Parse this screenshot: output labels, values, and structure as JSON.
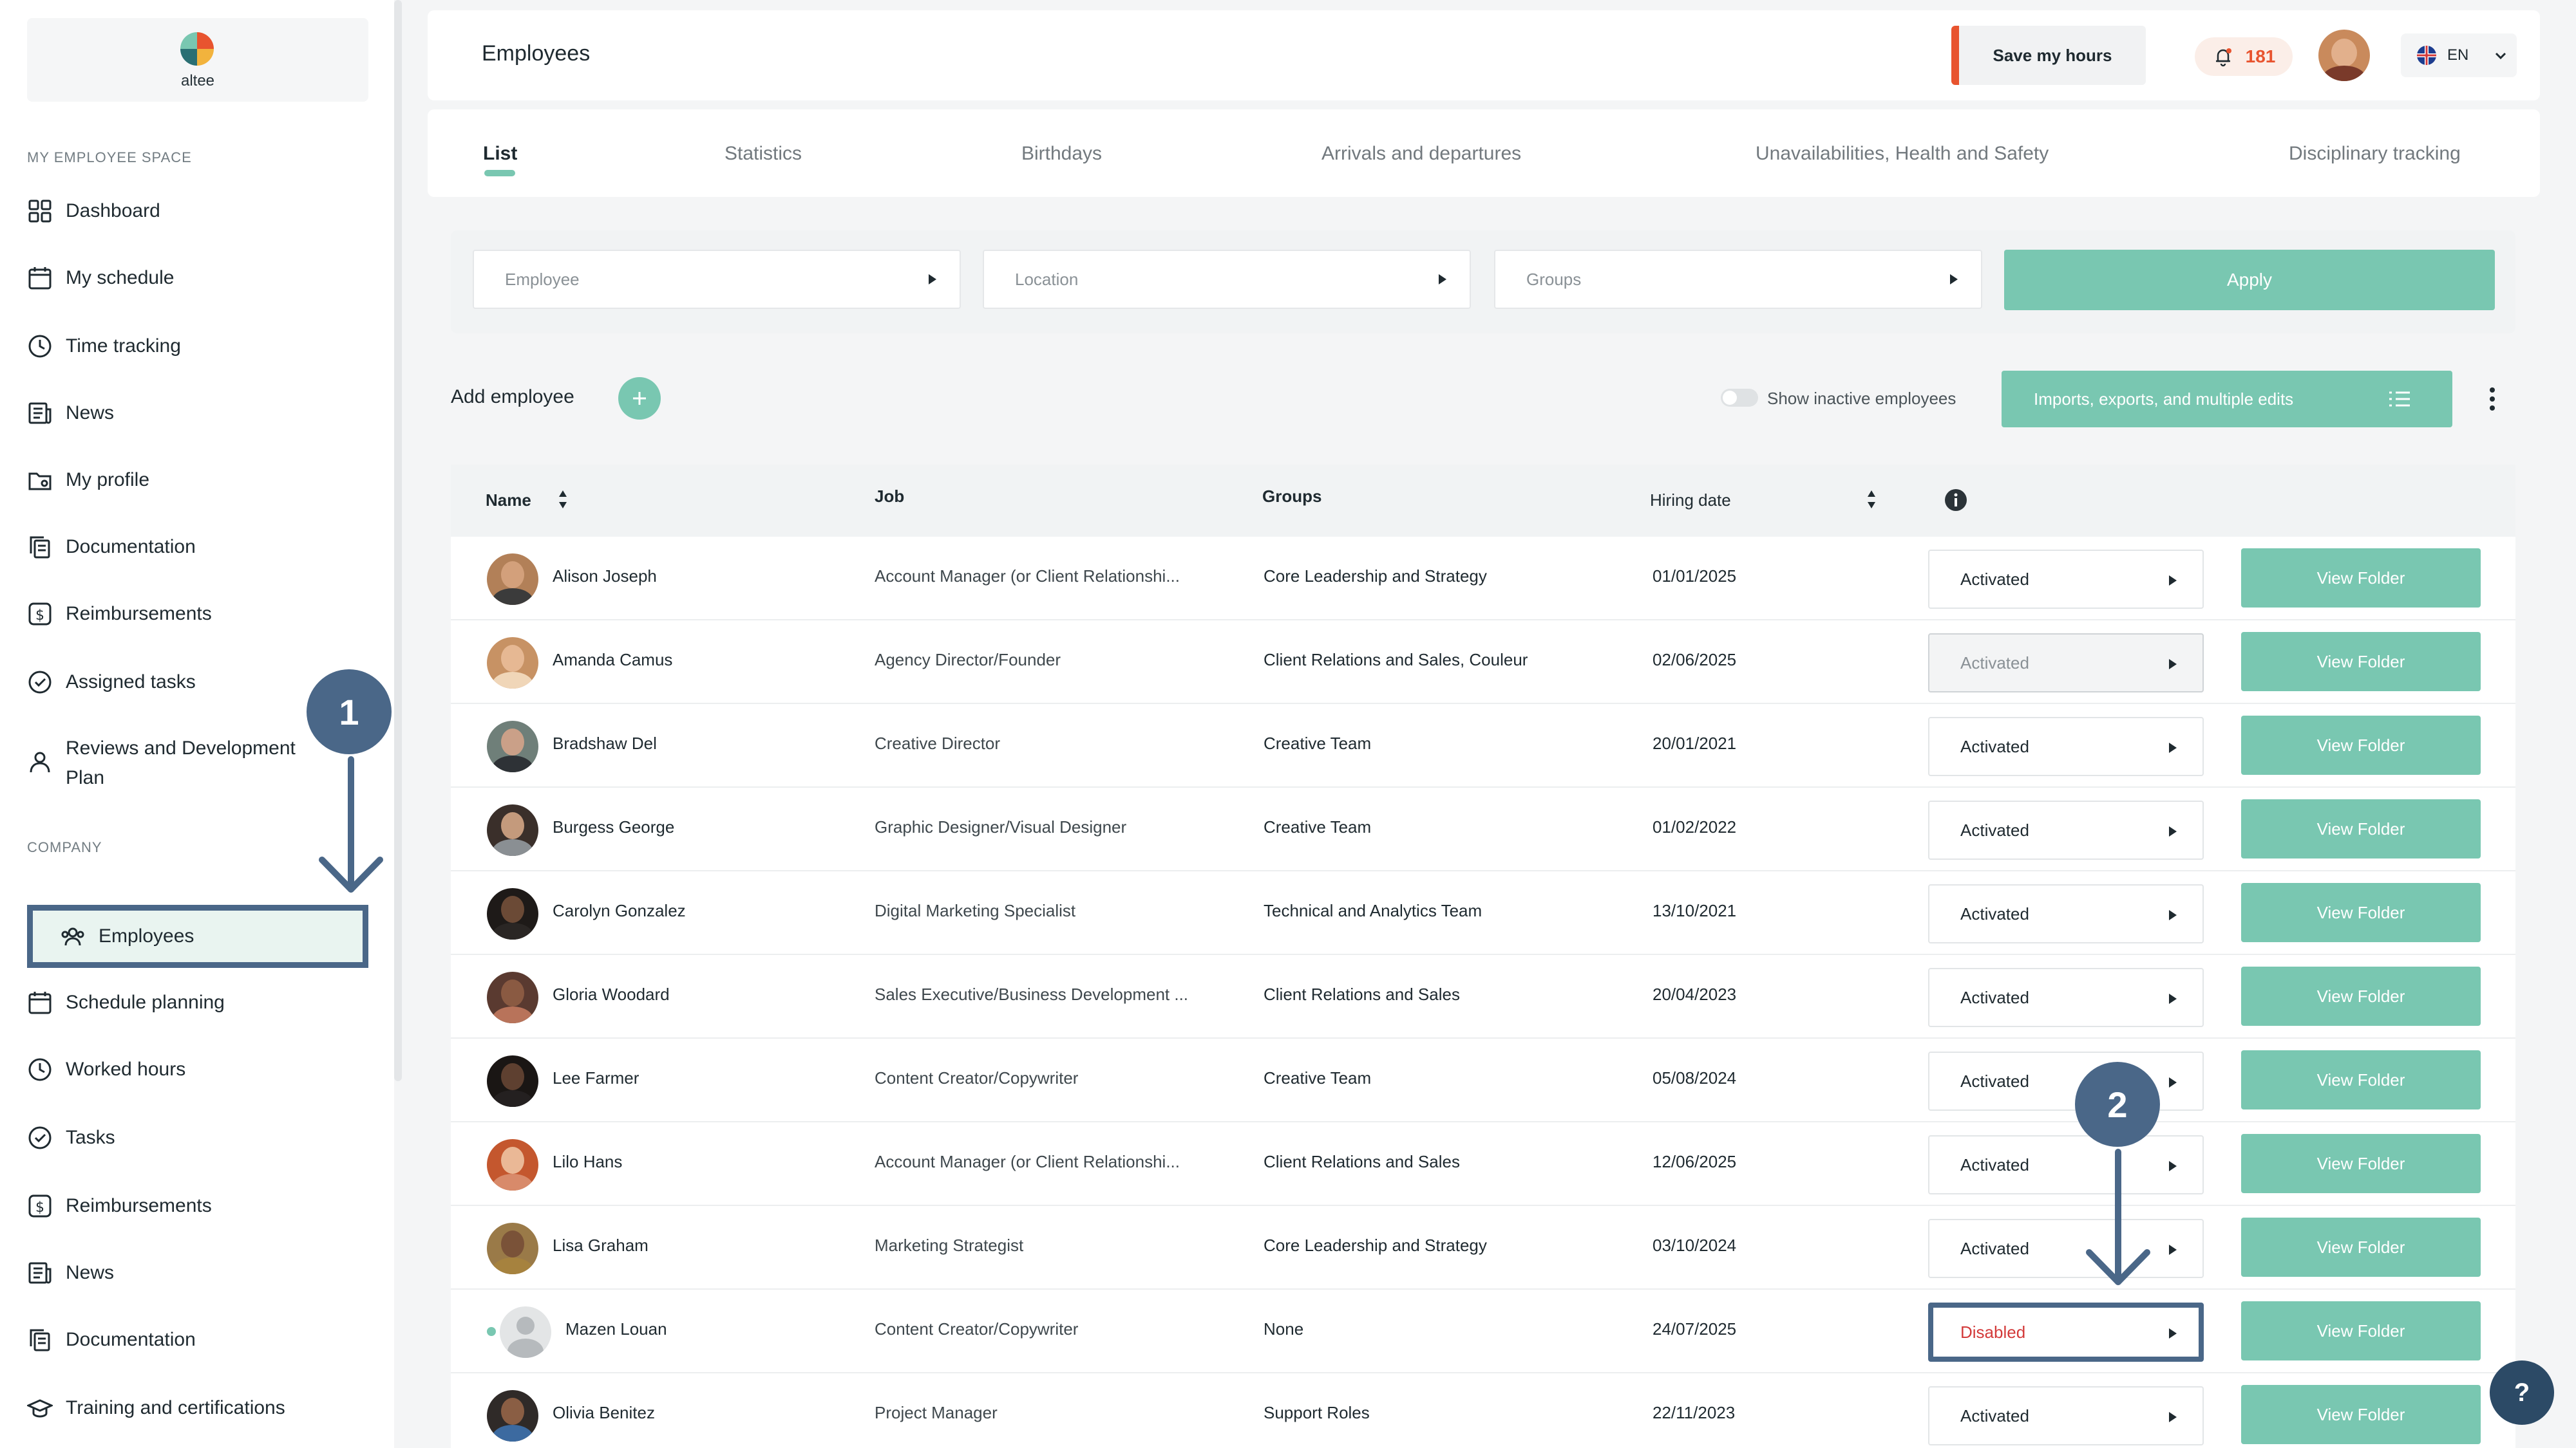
{
  "app": {
    "logo_text": "altee"
  },
  "sidebar": {
    "section_personal": "MY EMPLOYEE SPACE",
    "personal_items": [
      {
        "label": "Dashboard",
        "icon": "dashboard-icon"
      },
      {
        "label": "My schedule",
        "icon": "calendar-icon"
      },
      {
        "label": "Time tracking",
        "icon": "clock-icon"
      },
      {
        "label": "News",
        "icon": "news-icon"
      },
      {
        "label": "My profile",
        "icon": "folder-user-icon"
      },
      {
        "label": "Documentation",
        "icon": "documents-icon"
      },
      {
        "label": "Reimbursements",
        "icon": "dollar-icon"
      },
      {
        "label": "Assigned tasks",
        "icon": "check-circle-icon"
      },
      {
        "label": "Reviews and Development",
        "label2": "Plan",
        "icon": "person-icon"
      }
    ],
    "section_company": "COMPANY",
    "company_items": [
      {
        "label": "Employees",
        "icon": "users-icon",
        "active": true
      },
      {
        "label": "Schedule planning",
        "icon": "calendar-icon"
      },
      {
        "label": "Worked hours",
        "icon": "clock-icon"
      },
      {
        "label": "Tasks",
        "icon": "check-circle-icon"
      },
      {
        "label": "Reimbursements",
        "icon": "dollar-icon"
      },
      {
        "label": "News",
        "icon": "news-icon"
      },
      {
        "label": "Documentation",
        "icon": "documents-icon"
      },
      {
        "label": "Training and certifications",
        "icon": "graduation-icon"
      }
    ]
  },
  "header": {
    "title": "Employees",
    "save_hours_label": "Save my hours",
    "notification_count": "181",
    "language": "EN"
  },
  "tabs": [
    "List",
    "Statistics",
    "Birthdays",
    "Arrivals and departures",
    "Unavailabilities, Health and Safety",
    "Disciplinary tracking"
  ],
  "filters": {
    "employee_placeholder": "Employee",
    "location_placeholder": "Location",
    "groups_placeholder": "Groups",
    "apply_label": "Apply"
  },
  "toolbar": {
    "add_employee_label": "Add employee",
    "inactive_toggle_label": "Show inactive employees",
    "imports_label": "Imports, exports, and multiple edits"
  },
  "table": {
    "headers": {
      "name": "Name",
      "job": "Job",
      "groups": "Groups",
      "hiring_date": "Hiring date"
    },
    "view_label": "View Folder",
    "rows": [
      {
        "name": "Alison Joseph",
        "job": "Account Manager (or Client Relationshi...",
        "groups": "Core Leadership and Strategy",
        "date": "01/01/2025",
        "status": "Activated"
      },
      {
        "name": "Amanda Camus",
        "job": "Agency Director/Founder",
        "groups": "Client Relations and Sales, Couleur",
        "date": "02/06/2025",
        "status": "Activated"
      },
      {
        "name": "Bradshaw Del",
        "job": "Creative Director",
        "groups": "Creative Team",
        "date": "20/01/2021",
        "status": "Activated"
      },
      {
        "name": "Burgess George",
        "job": "Graphic Designer/Visual Designer",
        "groups": "Creative Team",
        "date": "01/02/2022",
        "status": "Activated"
      },
      {
        "name": "Carolyn Gonzalez",
        "job": "Digital Marketing Specialist",
        "groups": "Technical and Analytics Team",
        "date": "13/10/2021",
        "status": "Activated"
      },
      {
        "name": "Gloria Woodard",
        "job": "Sales Executive/Business Development ...",
        "groups": "Client Relations and Sales",
        "date": "20/04/2023",
        "status": "Activated"
      },
      {
        "name": "Lee Farmer",
        "job": "Content Creator/Copywriter",
        "groups": "Creative Team",
        "date": "05/08/2024",
        "status": "Activated"
      },
      {
        "name": "Lilo Hans",
        "job": "Account Manager (or Client Relationshi...",
        "groups": "Client Relations and Sales",
        "date": "12/06/2025",
        "status": "Activated"
      },
      {
        "name": "Lisa Graham",
        "job": "Marketing Strategist",
        "groups": "Core Leadership and Strategy",
        "date": "03/10/2024",
        "status": "Activated"
      },
      {
        "name": "Mazen Louan",
        "job": "Content Creator/Copywriter",
        "groups": "None",
        "date": "24/07/2025",
        "status": "Disabled"
      },
      {
        "name": "Olivia Benitez",
        "job": "Project Manager",
        "groups": "Support Roles",
        "date": "22/11/2023",
        "status": "Activated"
      }
    ]
  },
  "callouts": [
    "1",
    "2"
  ],
  "help_label": "?",
  "colors": {
    "accent": "#79c7b1",
    "callout": "#4a6788",
    "alert": "#e8542f",
    "disabled": "#d33a3a"
  }
}
